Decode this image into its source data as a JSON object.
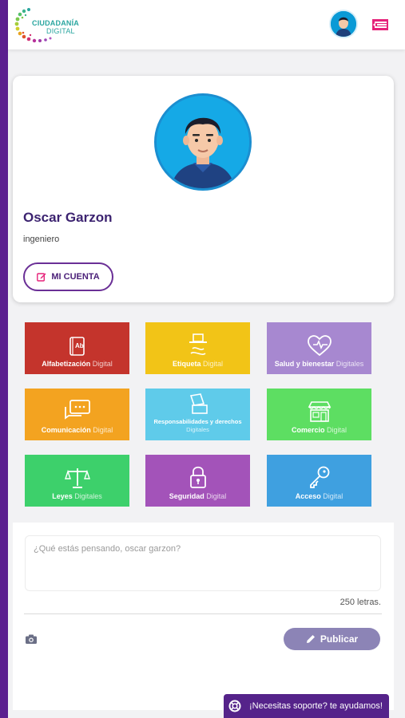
{
  "header": {
    "logo_line1": "CIUDADANÍA",
    "logo_line2": "DIGITAL",
    "menu_icon": "menu-icon",
    "avatar_icon": "user-avatar"
  },
  "profile": {
    "name": "Oscar Garzon",
    "role": "ingeniero",
    "account_button": "MI CUENTA"
  },
  "categories": [
    {
      "bold": "Alfabetización",
      "light": "Digital",
      "color": "#c4342c",
      "icon": "book-ab-icon"
    },
    {
      "bold": "Etiqueta",
      "light": "Digital",
      "color": "#f2c417",
      "icon": "hat-icon"
    },
    {
      "bold": "Salud y bienestar",
      "light": "Digitales",
      "color": "#a788d0",
      "icon": "heart-pulse-icon"
    },
    {
      "bold": "Comunicación",
      "light": "Digital",
      "color": "#f3a320",
      "icon": "chat-bubbles-icon"
    },
    {
      "bold": "Responsabilidades y derechos",
      "light": "Digitales",
      "color": "#5fcbea",
      "icon": "ballot-icon"
    },
    {
      "bold": "Comercio",
      "light": "Digital",
      "color": "#5dde62",
      "icon": "store-icon"
    },
    {
      "bold": "Leyes",
      "light": "Digitales",
      "color": "#3dd06b",
      "icon": "scales-icon"
    },
    {
      "bold": "Seguridad",
      "light": "Digital",
      "color": "#a353b9",
      "icon": "padlock-icon"
    },
    {
      "bold": "Acceso",
      "light": "Digital",
      "color": "#3fa0e0",
      "icon": "key-icon"
    }
  ],
  "post": {
    "placeholder": "¿Qué estás pensando, oscar garzon?",
    "letters": "250 letras.",
    "publish_label": "Publicar"
  },
  "support": {
    "label": "¡Necesitas soporte? te ayudamos!"
  }
}
